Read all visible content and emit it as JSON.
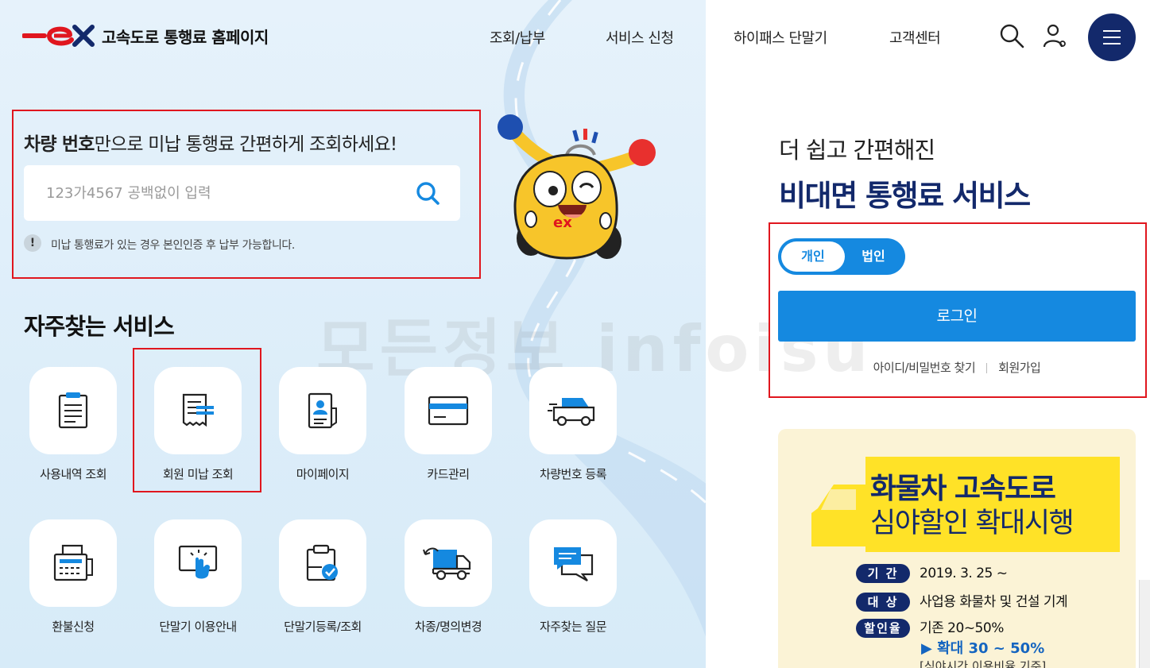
{
  "header": {
    "site_title": "고속도로 통행료 홈페이지",
    "nav": [
      "조회/납부",
      "서비스 신청",
      "하이패스 단말기",
      "고객센터"
    ],
    "icons": [
      "search-icon",
      "user-icon",
      "hamburger-menu-icon"
    ]
  },
  "search": {
    "title_bold": "차량 번호",
    "title_rest": "만으로 미납 통행료 간편하게 조회하세요!",
    "placeholder": "123가4567 공백없이 입력",
    "notice_icon": "!",
    "notice": "미납 통행료가 있는 경우 본인인증 후 납부 가능합니다."
  },
  "services": {
    "title": "자주찾는 서비스",
    "items": [
      {
        "label": "사용내역 조회",
        "icon": "document-list-icon"
      },
      {
        "label": "회원 미납 조회",
        "icon": "receipt-icon"
      },
      {
        "label": "마이페이지",
        "icon": "profile-card-icon"
      },
      {
        "label": "카드관리",
        "icon": "credit-card-icon"
      },
      {
        "label": "차량번호 등록",
        "icon": "car-icon"
      },
      {
        "label": "환불신청",
        "icon": "fax-machine-icon"
      },
      {
        "label": "단말기 이용안내",
        "icon": "touch-screen-icon"
      },
      {
        "label": "단말기등록/조회",
        "icon": "clipboard-check-icon"
      },
      {
        "label": "차종/명의변경",
        "icon": "truck-icon"
      },
      {
        "label": "자주찾는 질문",
        "icon": "chat-bubbles-icon"
      }
    ]
  },
  "watermark": "모든정보 infoisu",
  "right": {
    "subtitle": "더 쉽고 간편해진",
    "title": "비대면 통행료 서비스",
    "toggle": {
      "personal": "개인",
      "corporate": "법인",
      "selected": "개인"
    },
    "login": "로그인",
    "find_account": "아이디/비밀번호 찾기",
    "signup": "회원가입"
  },
  "banner": {
    "title1": "화물차 고속도로",
    "title2": "심야할인 확대시행",
    "rows": [
      {
        "tag": "기 간",
        "text": "2019. 3. 25 ~"
      },
      {
        "tag": "대 상",
        "text": "사업용 화물차 및 건설 기계"
      },
      {
        "tag": "할인율",
        "text": "기존 20~50%"
      }
    ],
    "highlight": "▶ 확대 30 ~ 50%",
    "note": "[심야시간 이용비율 기준]"
  },
  "colors": {
    "brand_navy": "#13296b",
    "accent_blue": "#1589e0",
    "brand_red": "#e0161e",
    "banner_bg": "#fbf3d6",
    "banner_yellow": "#ffe227"
  }
}
